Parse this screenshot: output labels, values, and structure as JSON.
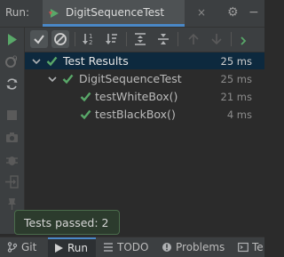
{
  "run_panel": {
    "label": "Run:",
    "tab": {
      "title": "DigitSequenceTest",
      "close": "×"
    },
    "gear": "⚙",
    "minimize": "−"
  },
  "tree": {
    "rows": [
      {
        "label": "Test Results",
        "time": "25 ms"
      },
      {
        "label": "DigitSequenceTest",
        "time": "25 ms"
      },
      {
        "label": "testWhiteBox()",
        "time": "21 ms"
      },
      {
        "label": "testBlackBox()",
        "time": "4 ms"
      }
    ]
  },
  "toast": {
    "text": "Tests passed: 2"
  },
  "bottom_bar": {
    "git": "Git",
    "run": "Run",
    "todo": "TODO",
    "problems": "Problems",
    "terminal": "Te"
  },
  "colors": {
    "accent_blue": "#4a88c7",
    "pass_green": "#59a869",
    "selection": "#0d293e",
    "background": "#2b2b2b"
  },
  "icons": [
    "run-config-icon",
    "rerun-icon",
    "show-passed-icon",
    "show-ignored-icon",
    "sort-alpha-icon",
    "sort-duration-icon",
    "expand-all-icon",
    "collapse-all-icon",
    "prev-failed-icon",
    "next-failed-icon",
    "check-icon",
    "chevron-down-icon"
  ]
}
